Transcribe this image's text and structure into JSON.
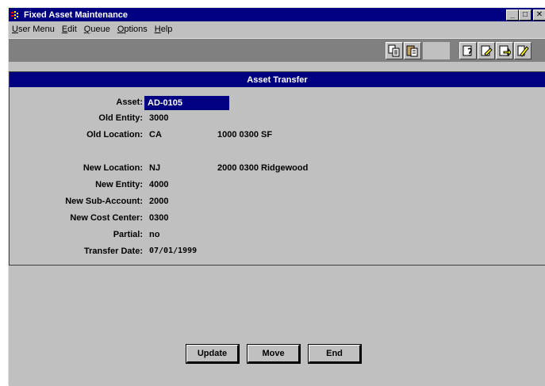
{
  "window": {
    "title": "Fixed Asset Maintenance",
    "minimize_glyph": "_",
    "maximize_glyph": "□",
    "close_glyph": "✕"
  },
  "menu": [
    {
      "label": "User Menu",
      "accel": "U",
      "rest": "ser Menu"
    },
    {
      "label": "Edit",
      "accel": "E",
      "rest": "dit"
    },
    {
      "label": "Queue",
      "accel": "Q",
      "rest": "ueue"
    },
    {
      "label": "Options",
      "accel": "O",
      "rest": "ptions"
    },
    {
      "label": "Help",
      "accel": "H",
      "rest": "elp"
    }
  ],
  "toolbar": {
    "icons": [
      "copy-icon",
      "paste-icon",
      "query-icon",
      "edit-record-icon",
      "save-record-icon",
      "exit-icon"
    ]
  },
  "panel": {
    "header": "Asset Transfer"
  },
  "fields": {
    "asset": {
      "label": "Asset:",
      "value": "AD-0105"
    },
    "old_entity": {
      "label": "Old Entity:",
      "value": "3000"
    },
    "old_location": {
      "label": "Old Location:",
      "value": "CA",
      "extra": "1000 0300 SF"
    },
    "new_location": {
      "label": "New Location:",
      "value": "NJ",
      "extra": "2000 0300 Ridgewood"
    },
    "new_entity": {
      "label": "New Entity:",
      "value": "4000"
    },
    "new_sub_account": {
      "label": "New Sub-Account:",
      "value": "2000"
    },
    "new_cost_center": {
      "label": "New Cost Center:",
      "value": "0300"
    },
    "partial": {
      "label": "Partial:",
      "value": "no"
    },
    "transfer_date": {
      "label": "Transfer Date:",
      "value": "07/01/1999"
    }
  },
  "buttons": {
    "update": "Update",
    "move": "Move",
    "end": "End"
  },
  "colors": {
    "title_bar": "#000080",
    "face": "#c0c0c0",
    "toolbar_bg": "#808080",
    "selected_field": "#000080"
  }
}
